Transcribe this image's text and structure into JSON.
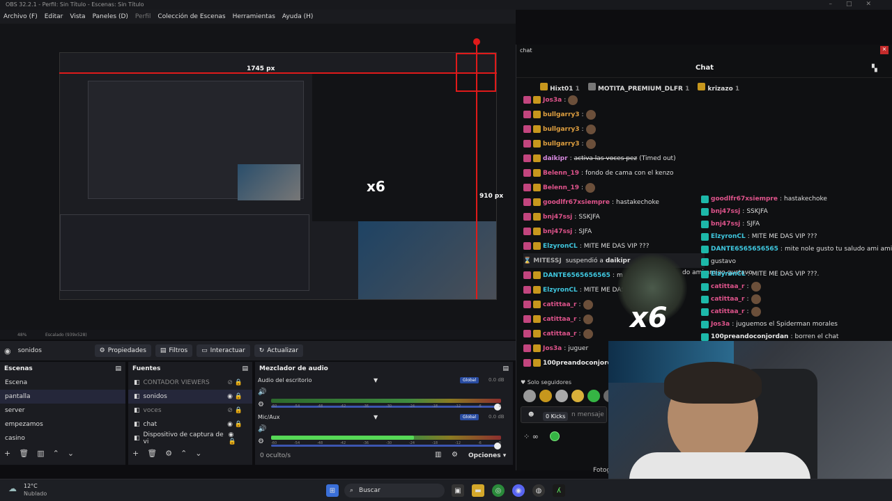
{
  "window": {
    "title": "OBS 32.2.1 - Perfil: Sin Título - Escenas: Sin Título"
  },
  "menu": [
    {
      "label": "Archivo (F)"
    },
    {
      "label": "Editar"
    },
    {
      "label": "Vista"
    },
    {
      "label": "Paneles (D)"
    },
    {
      "label": "Perfil"
    },
    {
      "label": "Colección de Escenas"
    },
    {
      "label": "Herramientas"
    },
    {
      "label": "Ayuda (H)"
    }
  ],
  "preview": {
    "width_label": "1745 px",
    "height_label": "910 px",
    "bottom_left": "48%",
    "scale_label": "Escalado (939x528)"
  },
  "source_toolbar": {
    "source_name": "sonidos",
    "buttons": [
      {
        "label": "Propiedades"
      },
      {
        "label": "Filtros"
      },
      {
        "label": "Interactuar"
      },
      {
        "label": "Actualizar"
      }
    ]
  },
  "scenes": {
    "title": "Escenas",
    "items": [
      "Escena",
      "pantalla",
      "server",
      "empezamos",
      "casino"
    ],
    "selected": "pantalla"
  },
  "sources": {
    "title": "Fuentes",
    "items": [
      "CONTADOR VIEWERS",
      "sonidos",
      "voces",
      "chat",
      "Dispositivo de captura de vi"
    ]
  },
  "mixer": {
    "title": "Mezclador de audio",
    "channels": [
      {
        "name": "Audio del escritorio",
        "badge": "Global",
        "db": "0.0 dB",
        "level": 0.0
      },
      {
        "name": "Mic/Aux",
        "badge": "Global",
        "db": "0.0 dB",
        "level": 0.62
      }
    ],
    "scale": [
      "-60",
      "-54",
      "-48",
      "-42",
      "-36",
      "-30",
      "-24",
      "-18",
      "-12",
      "-6",
      "0"
    ],
    "footer_left": "0 oculto/s",
    "options": "Opciones"
  },
  "chat": {
    "window_label": "chat",
    "header": "Chat",
    "top_users": [
      {
        "name": "Hixt01",
        "count": "1"
      },
      {
        "name": "MOTITA_PREMIUM_DLFR",
        "count": "1"
      },
      {
        "name": "krizazo",
        "count": "1"
      }
    ],
    "messages": [
      {
        "user": "Jos3a",
        "text": "",
        "color": "#e0548c"
      },
      {
        "user": "bullgarry3",
        "text": "",
        "color": "#e0a040"
      },
      {
        "user": "bullgarry3",
        "text": "",
        "color": "#e0a040"
      },
      {
        "user": "bullgarry3",
        "text": "",
        "color": "#e0a040"
      },
      {
        "user": "daikipr",
        "text": "activa las voces pez",
        "suffix": "(Timed out)",
        "color": "#d88ae0",
        "strike": true
      },
      {
        "user": "Belenn_19",
        "text": "fondo de cama con el kenzo",
        "color": "#e0548c"
      },
      {
        "user": "Belenn_19",
        "text": "",
        "color": "#e0548c"
      },
      {
        "user": "goodlfr67xsiempre",
        "text": "hastakechoke",
        "color": "#e0548c"
      },
      {
        "user": "bnj47ssj",
        "text": "SSKJFA",
        "color": "#e0548c"
      },
      {
        "user": "bnj47ssj",
        "text": "SJFA",
        "color": "#e0548c"
      },
      {
        "user": "ElzyronCL",
        "text": "MITE ME DAS VIP ???",
        "color": "#3fc8e0"
      },
      {
        "user": "MITESSJ",
        "text": "suspendió a",
        "target": "daikipr",
        "color": "#aaa",
        "system": true
      },
      {
        "user": "DANTE6565656565",
        "text": "m",
        "color": "#3fc8e0"
      },
      {
        "user": "ElzyronCL",
        "text": "MITE ME DAS VIP ?",
        "color": "#3fc8e0"
      },
      {
        "user": "catittaa_r",
        "text": "",
        "color": "#e0548c"
      },
      {
        "user": "catittaa_r",
        "text": "",
        "color": "#e0548c"
      },
      {
        "user": "catittaa_r",
        "text": "",
        "color": "#e0548c"
      },
      {
        "user": "Jos3a",
        "text": "juguer",
        "color": "#e0548c"
      },
      {
        "user": "100preandoconjordan",
        "text": "",
        "color": "#e8e8e8"
      }
    ],
    "overlay_messages": [
      {
        "user": "goodlfr67xsiempre",
        "text": "hastakechoke",
        "color": "#e0548c"
      },
      {
        "user": "bnj47ssj",
        "text": "SSKJFA",
        "color": "#e0548c"
      },
      {
        "user": "bnj47ssj",
        "text": "SJFA",
        "color": "#e0548c"
      },
      {
        "user": "ElzyronCL",
        "text": "MITE ME DAS VIP ???",
        "color": "#3fc8e0"
      },
      {
        "user": "DANTE6565656565",
        "text": "mite nole gusto tu saludo ami amigo",
        "color": "#3fc8e0"
      },
      {
        "user": "",
        "text": "gustavo",
        "color": "#e8e8e8"
      },
      {
        "user": "ElzyronCL",
        "text": "MITE ME DAS VIP ???.",
        "color": "#3fc8e0"
      },
      {
        "user": "catittaa_r",
        "text": "",
        "color": "#e0548c"
      },
      {
        "user": "catittaa_r",
        "text": "",
        "color": "#e0548c"
      },
      {
        "user": "catittaa_r",
        "text": "",
        "color": "#e0548c"
      },
      {
        "user": "Jos3a",
        "text": "juguemos el Spiderman morales",
        "color": "#e0548c"
      },
      {
        "user": "100preandoconjordan",
        "text": "borren el chat",
        "color": "#e8e8e8"
      }
    ],
    "dante_tail": "do ami amigo gustavo",
    "followers_only": "Solo seguidores",
    "input_placeholder": "n mensaje",
    "tooltip": "0 Kicks",
    "x6": "x6",
    "foto": "Fotog"
  },
  "taskbar": {
    "temp": "12°C",
    "weather": "Nublado",
    "search": "Buscar"
  },
  "colors": {
    "accent": "#3c55b0",
    "red": "#e01a1a",
    "bg": "#0d0d10"
  }
}
